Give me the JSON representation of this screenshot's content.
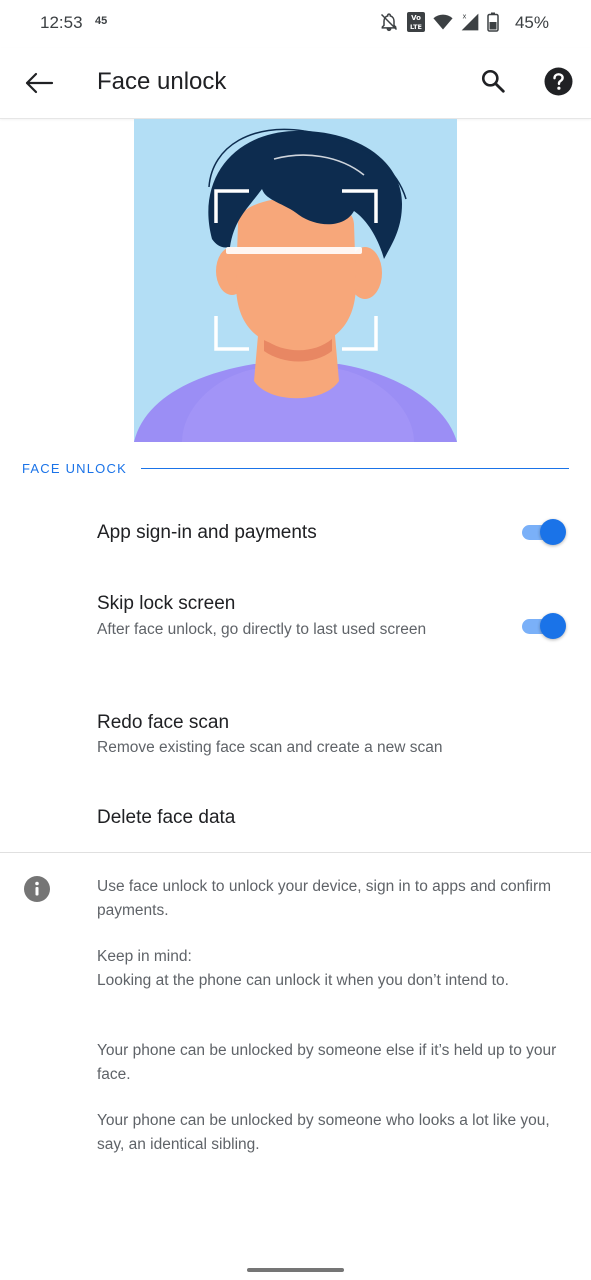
{
  "status_bar": {
    "time": "12:53",
    "small_indicator": "45",
    "battery_percent": "45%",
    "icons": [
      "notifications-off-icon",
      "volte-icon",
      "wifi-icon",
      "signal-icon",
      "battery-icon"
    ]
  },
  "app_bar": {
    "title": "Face unlock",
    "icons": [
      "back-arrow-icon",
      "search-icon",
      "help-icon"
    ]
  },
  "section": {
    "header": "FACE UNLOCK"
  },
  "preferences": [
    {
      "title": "App sign-in and payments",
      "summary": "",
      "toggle": true
    },
    {
      "title": "Skip lock screen",
      "summary": "After face unlock, go directly to last used screen",
      "toggle": true
    },
    {
      "title": "Redo face scan",
      "summary": "Remove existing face scan and create a new scan"
    },
    {
      "title": "Delete face data",
      "summary": ""
    }
  ],
  "footer": {
    "paragraph1": "Use face unlock to unlock your device, sign in to apps and confirm payments.",
    "keep_in_mind": "Keep in mind:",
    "paragraph2": "Looking at the phone can unlock it when you don’t intend to.",
    "paragraph3": "Your phone can be unlocked by someone else if it’s held up to your face.",
    "paragraph4": "Your phone can be unlocked by someone who looks a lot like you, say, an identical sibling."
  },
  "colors": {
    "accent": "#1a73e8",
    "illustration_bg": "#b3def5",
    "hair": "#0d2c4f",
    "skin": "#f7a77a",
    "shirt": "#9b8ef5"
  }
}
